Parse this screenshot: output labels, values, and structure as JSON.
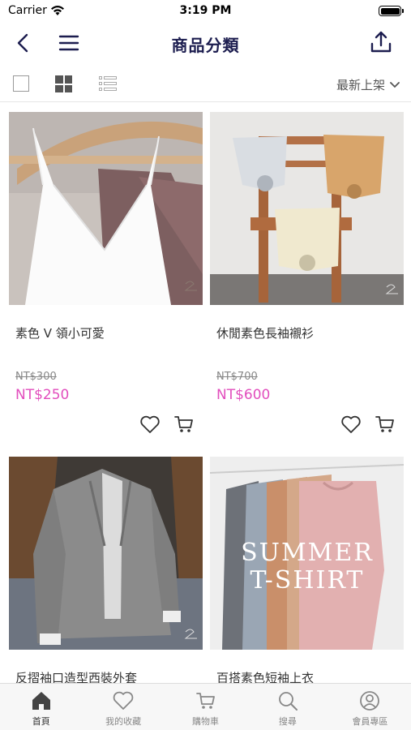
{
  "status_bar": {
    "carrier": "Carrier",
    "time": "3:19 PM"
  },
  "nav": {
    "title": "商品分類"
  },
  "toolbar": {
    "sort_label": "最新上架"
  },
  "products": [
    {
      "name": "素色 V 領小可愛",
      "old_price": "NT$300",
      "price": "NT$250"
    },
    {
      "name": "休閒素色長袖襯衫",
      "old_price": "NT$700",
      "price": "NT$600"
    },
    {
      "name": "反摺袖口造型西裝外套",
      "old_price": "",
      "price": ""
    },
    {
      "name": "百搭素色短袖上衣",
      "old_price": "",
      "price": "",
      "image_text": [
        "SUMMER",
        "T-SHIRT"
      ]
    }
  ],
  "tabs": [
    {
      "label": "首頁",
      "icon": "home-icon",
      "active": true
    },
    {
      "label": "我的收藏",
      "icon": "heart-icon",
      "active": false
    },
    {
      "label": "購物車",
      "icon": "cart-icon",
      "active": false
    },
    {
      "label": "搜尋",
      "icon": "search-icon",
      "active": false
    },
    {
      "label": "會員專區",
      "icon": "user-icon",
      "active": false
    }
  ],
  "colors": {
    "title": "#1c1d4f",
    "price": "#e24ebd",
    "tab_active": "#333333",
    "tab_inactive": "#888888"
  }
}
